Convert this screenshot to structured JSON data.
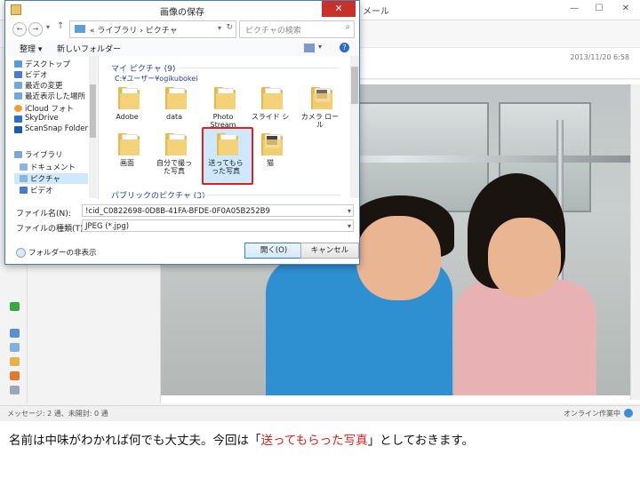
{
  "background_app": {
    "title_suffix": "メール",
    "date": "2013/11/20 6:58",
    "status_left": "メッセージ: 2 通、未開封: 0 通",
    "status_right": "オンライン作業中"
  },
  "dialog": {
    "title": "画像の保存",
    "close_label": "✕",
    "address": "« ライブラリ › ピクチャ",
    "search_placeholder": "ピクチャの検索",
    "toolbar": {
      "organize": "整理 ▾",
      "new_folder": "新しいフォルダー"
    },
    "nav_items": [
      {
        "label": "デスクトップ",
        "color": "#5b9bd5"
      },
      {
        "label": "ビデオ",
        "color": "#4b7cc2"
      },
      {
        "label": "最近の変更",
        "color": "#6fa8dc"
      },
      {
        "label": "最近表示した場所",
        "color": "#6fa8dc"
      },
      {
        "label": "iCloud フォト",
        "color": "#f0a030"
      },
      {
        "label": "SkyDrive",
        "color": "#2c6fc9"
      },
      {
        "label": "ScanSnap Folder",
        "color": "#1e5aa8"
      },
      {
        "label": "ライブラリ",
        "color": "#7fa6d1"
      },
      {
        "label": "ドキュメント",
        "color": "#8fb4df"
      },
      {
        "label": "ピクチャ",
        "color": "#8fb4df"
      },
      {
        "label": "ビデオ",
        "color": "#4b7cc2"
      }
    ],
    "group_header": "マイ ピクチャ (9)",
    "group_path": "C:¥ユーザー¥ogikubokei",
    "group_header2": "パブリックのピクチャ (3)",
    "folders": [
      {
        "label": "Adobe"
      },
      {
        "label": "data"
      },
      {
        "label": "Photo Stream"
      },
      {
        "label": "スライド ショー"
      },
      {
        "label": "カメラ ロール"
      },
      {
        "label": "画面"
      },
      {
        "label": "自分で撮った写真"
      },
      {
        "label": "送ってもらった写真"
      },
      {
        "label": "猫"
      }
    ],
    "filename_label": "ファイル名(N):",
    "filename_value": "!cid_C0822698-0D8B-41FA-BFDE-0F0A05B252B9",
    "filetype_label": "ファイルの種類(T):",
    "filetype_value": "JPEG (*.jpg)",
    "hide_folders": "フォルダーの非表示",
    "open_button": "開く(O)",
    "cancel_button": "キャンセル"
  },
  "caption": {
    "part1": "名前は中味がわかれば何でも大丈夫。今回は「",
    "highlight": "送ってもらった写真",
    "part2": "」としておきます。"
  },
  "colors": {
    "highlight": "#e0201b",
    "accent": "#1e3e9b",
    "selection": "#cde8ff"
  }
}
